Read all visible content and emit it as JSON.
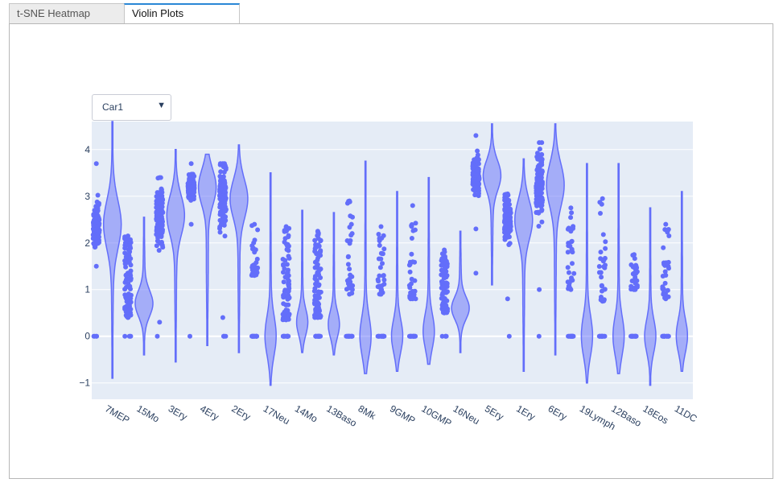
{
  "tabs": [
    {
      "label": "t-SNE Heatmap",
      "active": false
    },
    {
      "label": "Violin Plots",
      "active": true
    }
  ],
  "gene_select": {
    "selected": "Car1"
  },
  "colors": {
    "violin": "#636efa",
    "plot_bg": "#e5ecf6",
    "tab_accent": "#2a87d6"
  },
  "icons": {
    "dropdown": "caret-down-icon"
  },
  "chart_data": {
    "type": "violin",
    "title": "",
    "xlabel": "",
    "ylabel": "",
    "ylim": [
      -1.35,
      4.6
    ],
    "yticks": [
      -1,
      0,
      1,
      2,
      3,
      4
    ],
    "grid": true,
    "points": "all",
    "categories": [
      "7MEP",
      "15Mo",
      "3Ery",
      "4Ery",
      "2Ery",
      "17Neu",
      "14Mo",
      "13Baso",
      "8Mk",
      "9GMP",
      "10GMP",
      "16Neu",
      "5Ery",
      "1Ery",
      "6Ery",
      "19Lymph",
      "12Baso",
      "18Eos",
      "11DC"
    ],
    "series": [
      {
        "values_range": [
          -0.9,
          4.6
        ],
        "median": 2.4,
        "points": "0 (cluster), 1.5–3.7"
      },
      {
        "values_range": [
          -0.4,
          2.55
        ],
        "median": 0.7,
        "points": "0 (cluster), 0.4–2.15"
      },
      {
        "values_range": [
          -0.55,
          4.0
        ],
        "median": 2.6,
        "points": "0, 0.3–3.4"
      },
      {
        "values_range": [
          -0.2,
          3.9
        ],
        "median": 3.2,
        "points": "0, 2.4–3.7"
      },
      {
        "values_range": [
          -0.35,
          4.1
        ],
        "median": 2.95,
        "points": "0.4–3.7"
      },
      {
        "values_range": [
          -1.05,
          3.5
        ],
        "median": 0.0,
        "points": "0 (cluster), 1.3–2.4"
      },
      {
        "values_range": [
          -0.35,
          2.7
        ],
        "median": 0.3,
        "points": "0 (cluster), 0.35–2.35"
      },
      {
        "values_range": [
          -0.4,
          2.65
        ],
        "median": 0.25,
        "points": "0 (cluster), 0.4–2.25"
      },
      {
        "values_range": [
          -0.8,
          3.75
        ],
        "median": 0.0,
        "points": "0 (cluster), 0.9–2.9"
      },
      {
        "values_range": [
          -0.75,
          3.1
        ],
        "median": 0.0,
        "points": "0 (cluster), 0.9–2.35"
      },
      {
        "values_range": [
          -0.6,
          3.4
        ],
        "median": 0.1,
        "points": "0 (cluster), 0.8–2.8"
      },
      {
        "values_range": [
          -0.35,
          2.25
        ],
        "median": 0.6,
        "points": "0 (cluster), 0.5–1.85"
      },
      {
        "values_range": [
          1.1,
          4.55
        ],
        "median": 3.45,
        "points": "1.35, 2.3–4.3"
      },
      {
        "values_range": [
          -0.75,
          3.8
        ],
        "median": 2.5,
        "points": "0, 0.8–3.05"
      },
      {
        "values_range": [
          -0.4,
          4.55
        ],
        "median": 3.25,
        "points": "0, 1.0–4.15"
      },
      {
        "values_range": [
          -1.0,
          3.7
        ],
        "median": 0.0,
        "points": "0 (cluster), 1.0–2.75"
      },
      {
        "values_range": [
          -0.8,
          3.7
        ],
        "median": 0.0,
        "points": "0 (cluster), 0.75–2.95"
      },
      {
        "values_range": [
          -1.05,
          2.75
        ],
        "median": 0.0,
        "points": "0 (cluster), 1.0–1.75"
      },
      {
        "values_range": [
          -0.75,
          3.1
        ],
        "median": 0.0,
        "points": "0 (cluster), 0.8–2.4"
      }
    ]
  }
}
